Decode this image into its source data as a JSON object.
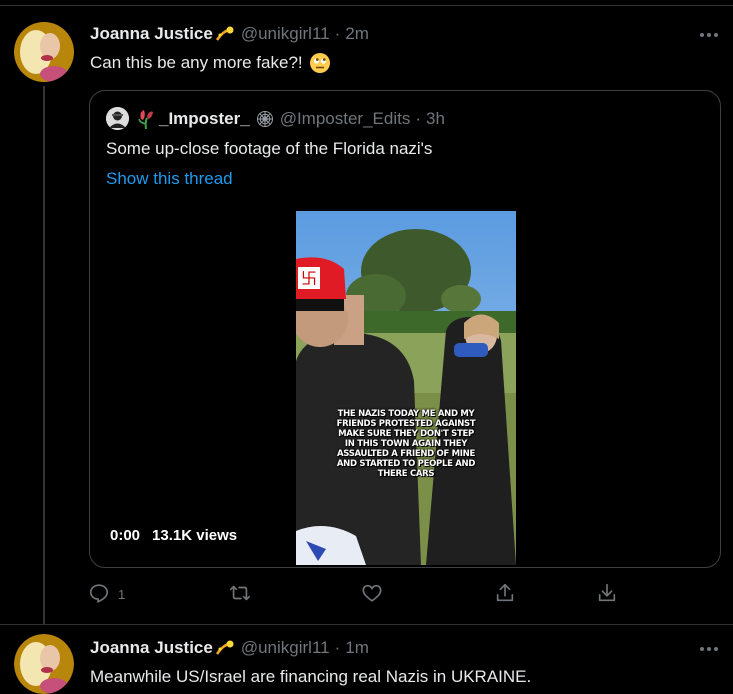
{
  "tweet1": {
    "name": "Joanna Justice",
    "handle": "@unikgirl11",
    "separator": "·",
    "time": "2m",
    "text": "Can this be any more fake?!",
    "reply_count": "1"
  },
  "quoted": {
    "name": "_Imposter_",
    "handle": "@Imposter_Edits",
    "separator": "·",
    "time": "3h",
    "text": "Some up-close footage of the Florida nazi's",
    "thread_link": "Show this thread",
    "video": {
      "overlay_caption": "THE NAZIS TODAY ME AND MY FRIENDS PROTESTED AGAINST MAKE SURE THEY DON'T STEP IN THIS TOWN AGAIN THEY ASSAULTED A FRIEND OF MINE AND STARTED TO PEOPLE AND THERE CARS",
      "timestamp": "0:00",
      "views": "13.1K views"
    }
  },
  "tweet2": {
    "name": "Joanna Justice",
    "handle": "@unikgirl11",
    "separator": "·",
    "time": "1m",
    "text": "Meanwhile US/Israel are financing real Nazis in UKRAINE."
  },
  "icons": {
    "reply": "reply-icon",
    "retweet": "retweet-icon",
    "like": "like-icon",
    "share": "share-icon",
    "download": "download-icon",
    "more": "more-icon"
  },
  "colors": {
    "background": "#000000",
    "text": "#e7e9ea",
    "secondary": "#71767b",
    "link": "#1d9bf0",
    "border": "#3e4144"
  }
}
